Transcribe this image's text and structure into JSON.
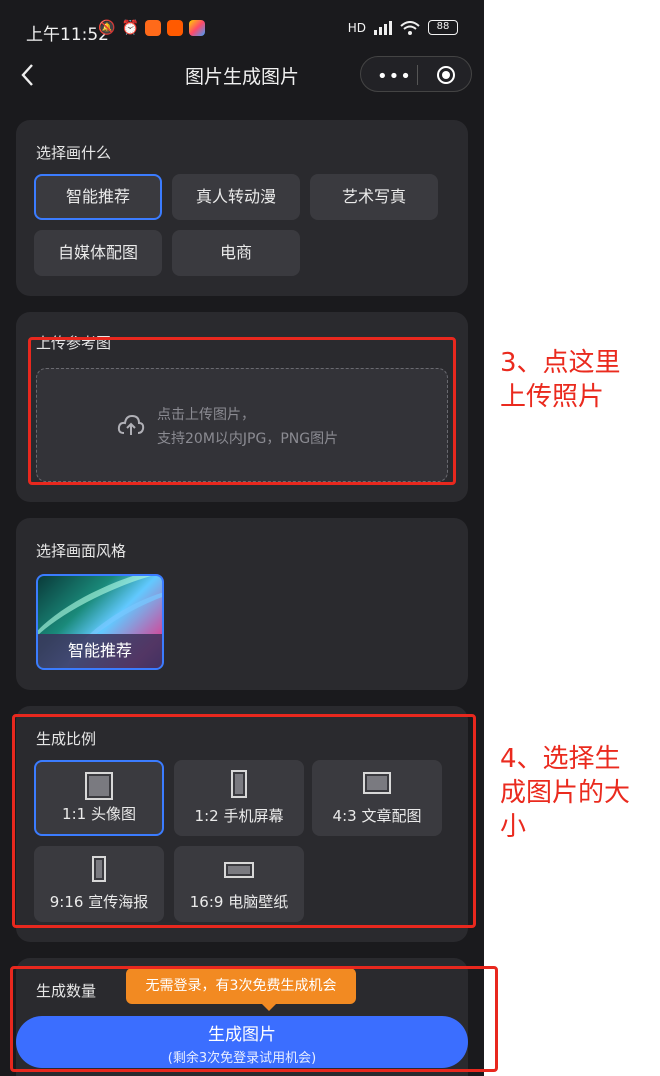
{
  "status": {
    "time": "上午11:52",
    "battery": "88",
    "network": "HD"
  },
  "nav": {
    "title": "图片生成图片",
    "more": "•••"
  },
  "section_subject": {
    "title": "选择画什么",
    "options": [
      {
        "label": "智能推荐",
        "selected": true
      },
      {
        "label": "真人转动漫",
        "selected": false
      },
      {
        "label": "艺术写真",
        "selected": false
      },
      {
        "label": "自媒体配图",
        "selected": false
      },
      {
        "label": "电商",
        "selected": false
      }
    ]
  },
  "section_upload": {
    "title": "上传参考图",
    "hint_line1": "点击上传图片，",
    "hint_line2": "支持20M以内JPG，PNG图片"
  },
  "section_style": {
    "title": "选择画面风格",
    "selected_label": "智能推荐"
  },
  "section_ratio": {
    "title": "生成比例",
    "options": [
      {
        "label": "1:1 头像图",
        "selected": true
      },
      {
        "label": "1:2 手机屏幕",
        "selected": false
      },
      {
        "label": "4:3 文章配图",
        "selected": false
      },
      {
        "label": "9:16 宣传海报",
        "selected": false
      },
      {
        "label": "16:9 电脑壁纸",
        "selected": false
      }
    ]
  },
  "section_count": {
    "title": "生成数量"
  },
  "tip": "无需登录，有3次免费生成机会",
  "generate_button": {
    "label": "生成图片",
    "sub": "(剩余3次免登录试用机会)"
  },
  "annotations": {
    "note3_line1": "3、点这里",
    "note3_line2": "上传照片",
    "note4_line1": "4、选择生",
    "note4_line2": "成图片的大",
    "note4_line3": "小",
    "color": "#e8281e"
  },
  "theme": {
    "accent": "#3b7cff",
    "button": "#3b6eff",
    "tip_bg": "#f28a22"
  }
}
